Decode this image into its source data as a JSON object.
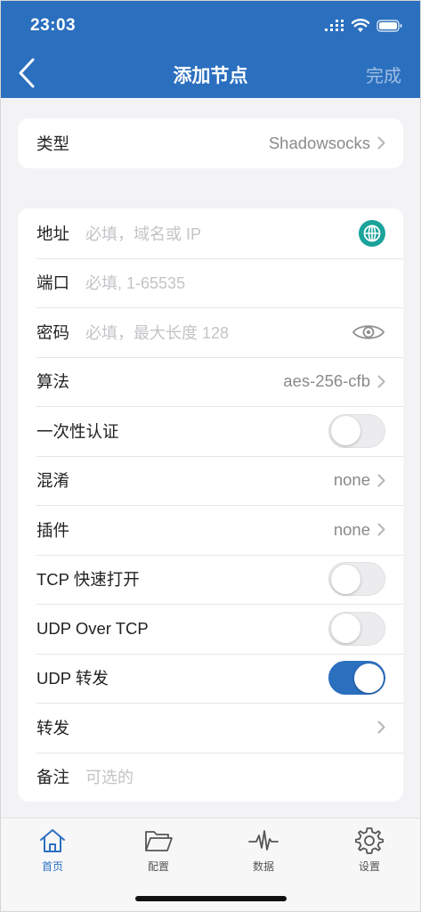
{
  "status": {
    "time": "23:03"
  },
  "nav": {
    "title": "添加节点",
    "done_label": "完成"
  },
  "type_row": {
    "label": "类型",
    "value": "Shadowsocks"
  },
  "form": {
    "address": {
      "label": "地址",
      "placeholder": "必填，域名或 IP"
    },
    "port": {
      "label": "端口",
      "placeholder": "必填, 1-65535"
    },
    "password": {
      "label": "密码",
      "placeholder": "必填，最大长度 128"
    },
    "algorithm": {
      "label": "算法",
      "value": "aes-256-cfb"
    },
    "one_time_auth": {
      "label": "一次性认证",
      "on": false
    },
    "obfs": {
      "label": "混淆",
      "value": "none"
    },
    "plugin": {
      "label": "插件",
      "value": "none"
    },
    "tcp_fast_open": {
      "label": "TCP 快速打开",
      "on": false
    },
    "udp_over_tcp": {
      "label": "UDP Over TCP",
      "on": false
    },
    "udp_relay": {
      "label": "UDP 转发",
      "on": true
    },
    "forward": {
      "label": "转发"
    },
    "remark": {
      "label": "备注",
      "placeholder": "可选的"
    }
  },
  "tabs": [
    {
      "label": "首页",
      "icon": "home-icon",
      "active": true
    },
    {
      "label": "配置",
      "icon": "folder-icon",
      "active": false
    },
    {
      "label": "数据",
      "icon": "pulse-icon",
      "active": false
    },
    {
      "label": "设置",
      "icon": "gear-icon",
      "active": false
    }
  ],
  "colors": {
    "accent": "#2b6fbf",
    "globe": "#1aa39a"
  }
}
